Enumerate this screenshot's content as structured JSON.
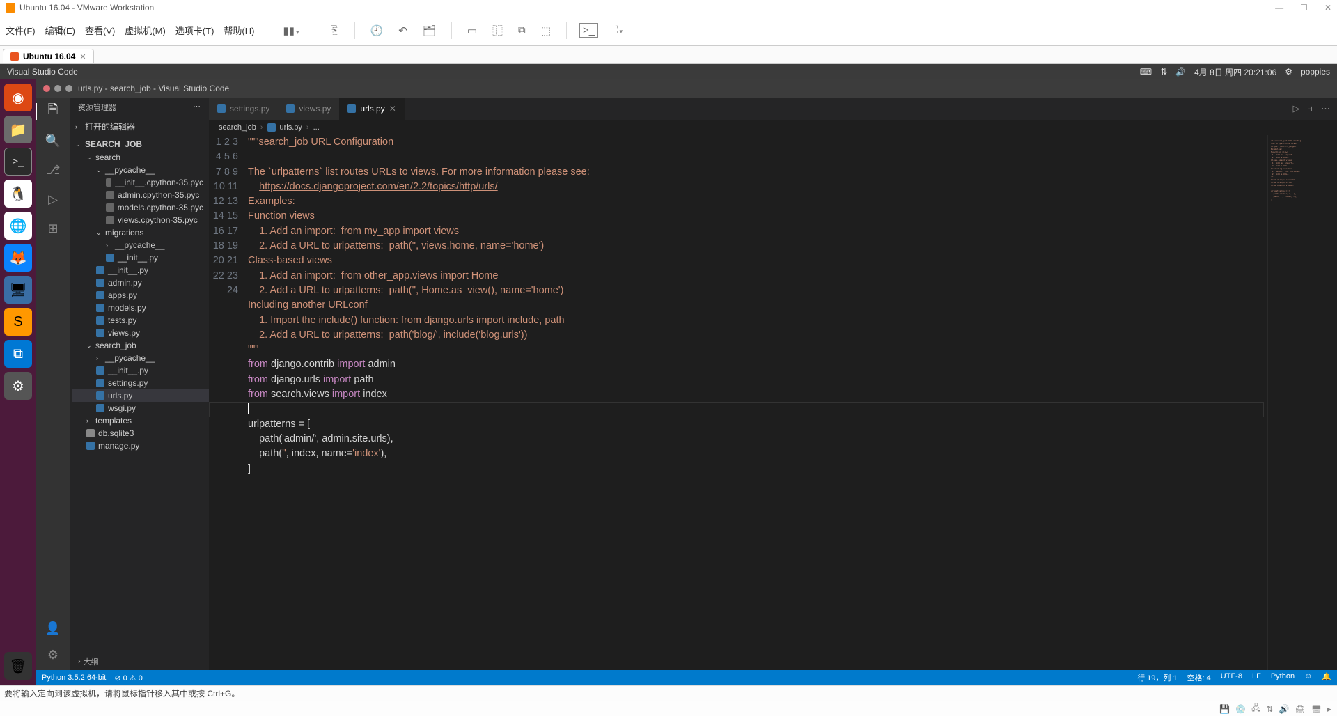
{
  "vmware": {
    "title": "Ubuntu 16.04 - VMware Workstation",
    "menus": [
      "文件(F)",
      "编辑(E)",
      "查看(V)",
      "虚拟机(M)",
      "选项卡(T)",
      "帮助(H)"
    ],
    "tab_label": "Ubuntu 16.04",
    "hint": "要将输入定向到该虚拟机，请将鼠标指针移入其中或按 Ctrl+G。"
  },
  "ubuntu": {
    "topbar_title": "Visual Studio Code",
    "datetime": "4月 8日 周四 20:21:06",
    "user": "poppies"
  },
  "vscode": {
    "window_title": "urls.py - search_job - Visual Studio Code",
    "explorer_label": "资源管理器",
    "open_editors_label": "打开的编辑器",
    "project": "SEARCH_JOB",
    "outline_label": "大纲",
    "tabs": [
      {
        "label": "settings.py",
        "active": false
      },
      {
        "label": "views.py",
        "active": false
      },
      {
        "label": "urls.py",
        "active": true
      }
    ],
    "breadcrumb": [
      "search_job",
      "urls.py",
      "..."
    ],
    "tree": {
      "search": "search",
      "pycache1": "__pycache__",
      "init_pyc": "__init__.cpython-35.pyc",
      "admin_pyc": "admin.cpython-35.pyc",
      "models_pyc": "models.cpython-35.pyc",
      "views_pyc": "views.cpython-35.pyc",
      "migrations": "migrations",
      "pycache2": "__pycache__",
      "init_py": "__init__.py",
      "init_py2": "__init__.py",
      "admin_py": "admin.py",
      "apps_py": "apps.py",
      "models_py": "models.py",
      "tests_py": "tests.py",
      "views_py": "views.py",
      "search_job": "search_job",
      "pycache3": "__pycache__",
      "init_py3": "__init__.py",
      "settings_py": "settings.py",
      "urls_py": "urls.py",
      "wsgi_py": "wsgi.py",
      "templates": "templates",
      "db": "db.sqlite3",
      "manage_py": "manage.py"
    },
    "code": {
      "l1": "\"\"\"search_job URL Configuration",
      "l2": "",
      "l3": "The `urlpatterns` list routes URLs to views. For more information please see:",
      "l4_pre": "    ",
      "l4_url": "https://docs.djangoproject.com/en/2.2/topics/http/urls/",
      "l5": "Examples:",
      "l6": "Function views",
      "l7": "    1. Add an import:  from my_app import views",
      "l8": "    2. Add a URL to urlpatterns:  path('', views.home, name='home')",
      "l9": "Class-based views",
      "l10": "    1. Add an import:  from other_app.views import Home",
      "l11": "    2. Add a URL to urlpatterns:  path('', Home.as_view(), name='home')",
      "l12": "Including another URLconf",
      "l13": "    1. Import the include() function: from django.urls import include, path",
      "l14": "    2. Add a URL to urlpatterns:  path('blog/', include('blog.urls'))",
      "l15": "\"\"\"",
      "l16_from": "from",
      "l16_mod": " django.contrib ",
      "l16_imp": "import",
      "l16_name": " admin",
      "l17_from": "from",
      "l17_mod": " django.urls ",
      "l17_imp": "import",
      "l17_name": " path",
      "l18_from": "from",
      "l18_mod": " search.views ",
      "l18_imp": "import",
      "l18_name": " index",
      "l20": "urlpatterns = [",
      "l21": "    path('admin/', admin.site.urls),",
      "l22_a": "    path(",
      "l22_b": "''",
      "l22_c": ", index, ",
      "l22_d": "name",
      "l22_e": "=",
      "l22_f": "'index'",
      "l22_g": "),",
      "l23": "]"
    },
    "status": {
      "python": "Python 3.5.2 64-bit",
      "problems": "⊘ 0 ⚠ 0",
      "pos": "行 19，列 1",
      "spaces": "空格: 4",
      "enc": "UTF-8",
      "eol": "LF",
      "lang": "Python"
    }
  }
}
